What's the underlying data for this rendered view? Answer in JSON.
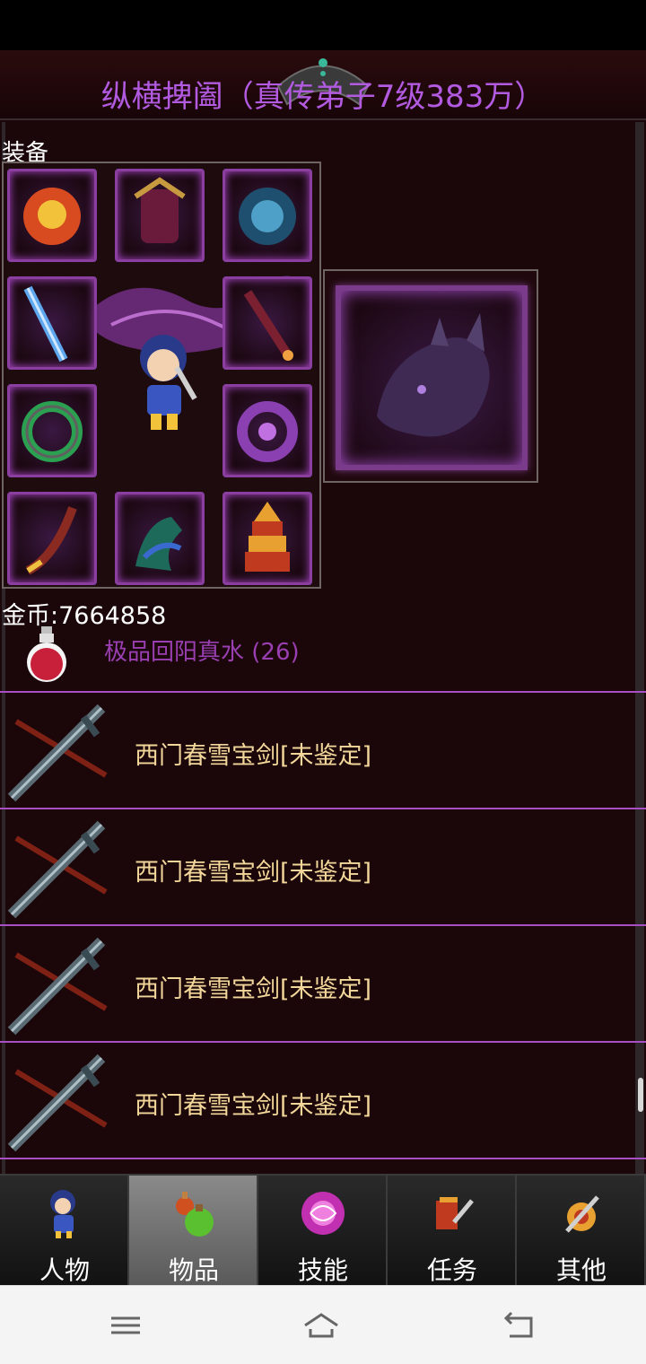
{
  "game": {
    "title": "纵横捭阖（真传弟子7级383万）",
    "section_label": "装备",
    "gold_label": "金币:7664858",
    "potion": {
      "name": "极品回阳真水 (26)"
    },
    "items": [
      {
        "name": "西门春雪宝剑[未鉴定]"
      },
      {
        "name": "西门春雪宝剑[未鉴定]"
      },
      {
        "name": "西门春雪宝剑[未鉴定]"
      },
      {
        "name": "西门春雪宝剑[未鉴定]"
      }
    ],
    "equip_slots": [
      {
        "icon": "crown-icon"
      },
      {
        "icon": "armor-icon"
      },
      {
        "icon": "shield-icon"
      },
      {
        "icon": "spear-icon"
      },
      {
        "icon": "staff-icon"
      },
      {
        "icon": "ring-icon"
      },
      {
        "icon": "bracelet-icon"
      },
      {
        "icon": "horn-icon"
      },
      {
        "icon": "boots-icon"
      },
      {
        "icon": "pagoda-icon"
      }
    ]
  },
  "tabs": [
    {
      "label": "人物",
      "icon": "character-icon",
      "active": false
    },
    {
      "label": "物品",
      "icon": "potion-bag-icon",
      "active": true
    },
    {
      "label": "技能",
      "icon": "skill-orb-icon",
      "active": false
    },
    {
      "label": "任务",
      "icon": "quest-icon",
      "active": false
    },
    {
      "label": "其他",
      "icon": "misc-icon",
      "active": false
    }
  ],
  "colors": {
    "title": "#b25ae0",
    "potion_text": "#9a3fb2",
    "item_text": "#f3d79a",
    "divider": "#a84fc4",
    "background": "#1b0709"
  }
}
